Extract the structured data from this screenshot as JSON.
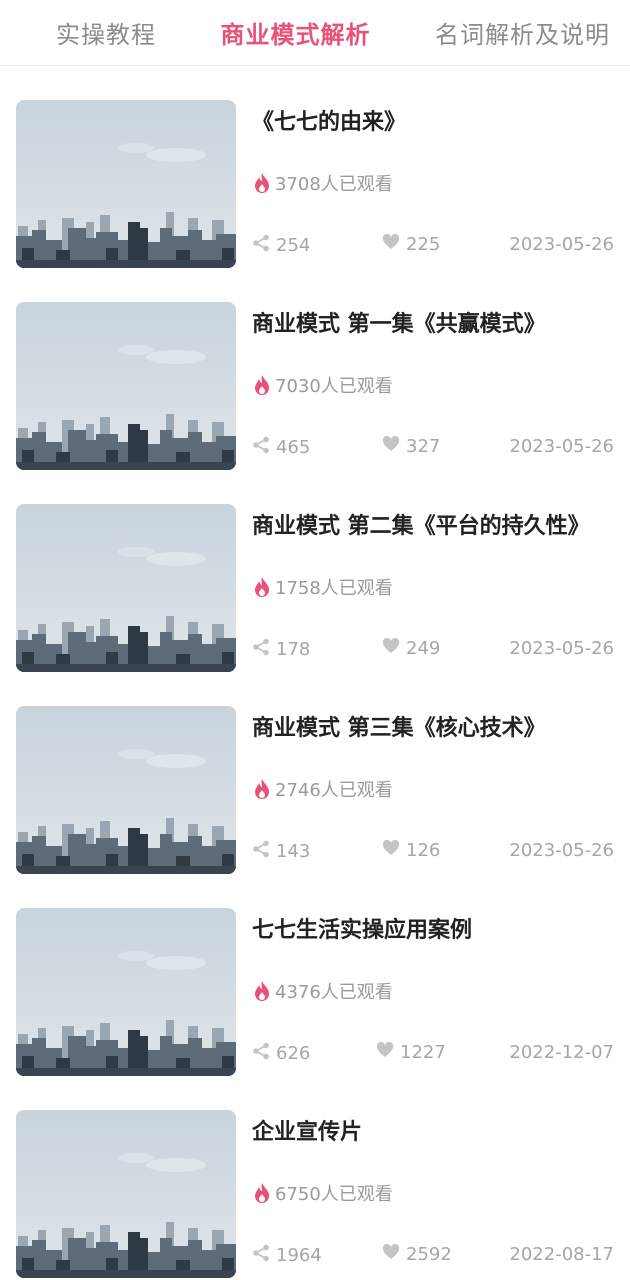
{
  "tabs": [
    {
      "label": "实操教程",
      "active": false
    },
    {
      "label": "商业模式解析",
      "active": true
    },
    {
      "label": "名词解析及说明",
      "active": false
    }
  ],
  "colors": {
    "accent": "#e8527a",
    "muted": "#9a9a9a"
  },
  "icons": {
    "views": "fire-icon",
    "shares": "share-icon",
    "likes": "heart-icon"
  },
  "items": [
    {
      "title": "《七七的由来》",
      "views": "3708人已观看",
      "shares": "254",
      "likes": "225",
      "date": "2023-05-26"
    },
    {
      "title": "商业模式 第一集《共赢模式》",
      "views": "7030人已观看",
      "shares": "465",
      "likes": "327",
      "date": "2023-05-26"
    },
    {
      "title": "商业模式 第二集《平台的持久性》",
      "views": "1758人已观看",
      "shares": "178",
      "likes": "249",
      "date": "2023-05-26"
    },
    {
      "title": "商业模式 第三集《核心技术》",
      "views": "2746人已观看",
      "shares": "143",
      "likes": "126",
      "date": "2023-05-26"
    },
    {
      "title": "七七生活实操应用案例",
      "views": "4376人已观看",
      "shares": "626",
      "likes": "1227",
      "date": "2022-12-07"
    },
    {
      "title": "企业宣传片",
      "views": "6750人已观看",
      "shares": "1964",
      "likes": "2592",
      "date": "2022-08-17"
    }
  ]
}
